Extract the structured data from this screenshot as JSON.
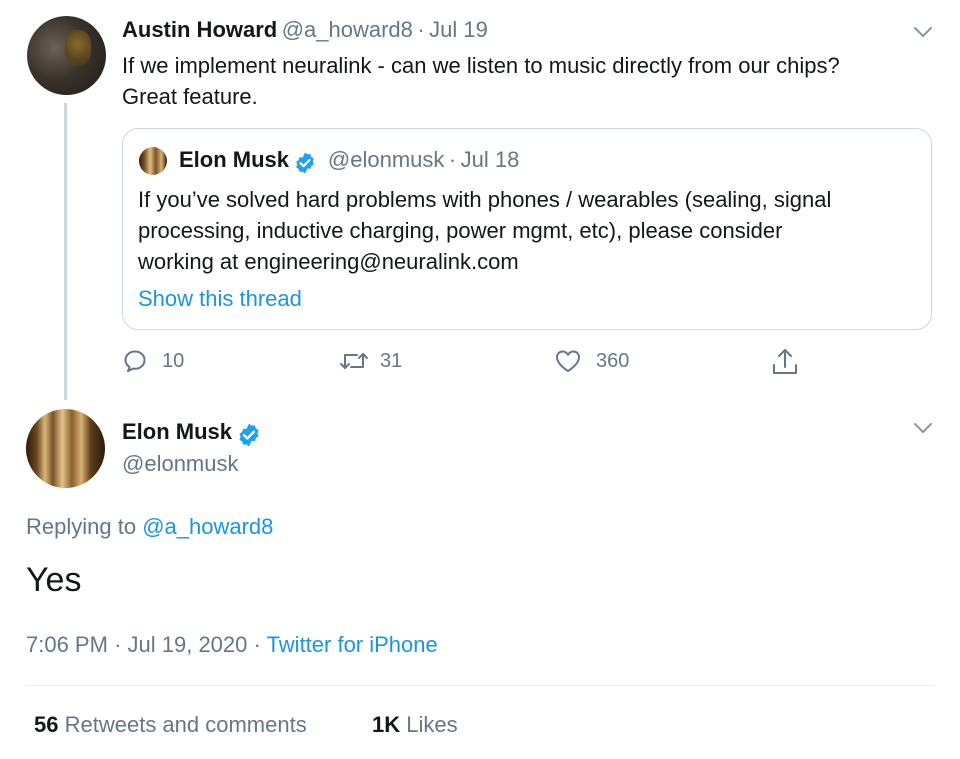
{
  "reply_tweet": {
    "author_name": "Austin Howard",
    "author_handle": "@a_howard8",
    "separator": "·",
    "date": "Jul 19",
    "text_line1": "If we implement neuralink - can we listen to music directly from our chips?",
    "text_line2": "Great feature."
  },
  "quoted_tweet": {
    "author_name": "Elon Musk",
    "author_handle": "@elonmusk",
    "separator": "·",
    "date": "Jul 18",
    "text_line1": "If you’ve solved hard problems with phones / wearables (sealing, signal",
    "text_line2": "processing, inductive charging, power mgmt, etc), please consider",
    "text_line3": "working at engineering@neuralink.com",
    "show_thread": "Show this thread"
  },
  "actions": {
    "replies": "10",
    "retweets": "31",
    "likes": "360"
  },
  "main_tweet": {
    "author_name": "Elon Musk",
    "author_handle": "@elonmusk",
    "replying_prefix": "Replying to ",
    "replying_handle": "@a_howard8",
    "text": "Yes",
    "time": "7:06 PM",
    "dot1": "·",
    "date": "Jul 19, 2020",
    "dot2": "·",
    "source": "Twitter for iPhone"
  },
  "stats": {
    "retweets_count": "56",
    "retweets_label": "Retweets and comments",
    "likes_count": "1K",
    "likes_label": "Likes"
  },
  "colors": {
    "accent": "#1b95e0",
    "verified": "#1da1f2",
    "secondary_text": "#657786",
    "border": "#ccd6dd"
  },
  "icons": {
    "reply": "speech-bubble-icon",
    "retweet": "retweet-arrows-icon",
    "like": "heart-icon",
    "share": "share-upload-icon",
    "menu": "chevron-down-icon",
    "verified": "verified-badge-icon"
  }
}
